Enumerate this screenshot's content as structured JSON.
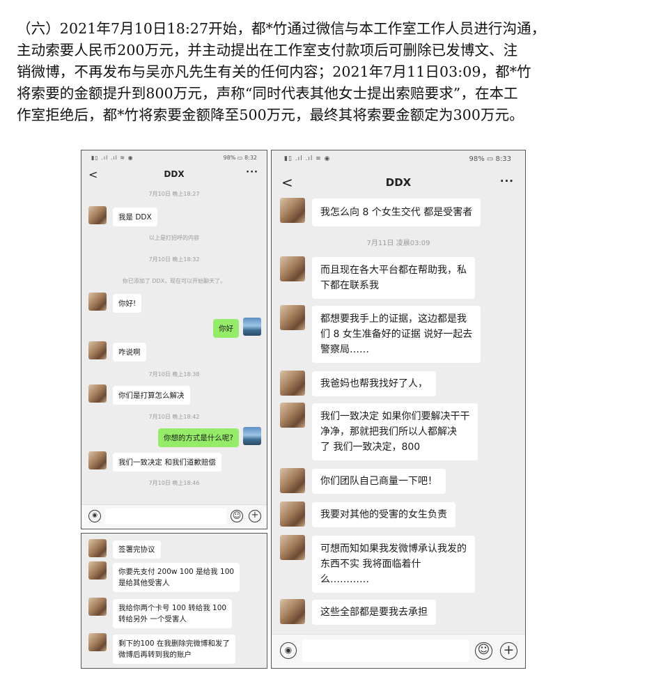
{
  "paragraph": {
    "lines": [
      "（六）2021年7月10日18:27开始，都*竹通过微信与本工作室工作人员进行沟通，",
      "主动索要人民币200万元，并主动提出在工作室支付款项后可删除已发博文、注",
      "销微博，不再发布与吴亦凡先生有关的任何内容；2021年7月11日03:09，都*竹",
      "将索要的金额提升到800万元，声称“同时代表其他女士提出索赔要求”，在本工",
      "作室拒绝后，都*竹将索要金额降至500万元，最终其将索要金额定为300万元。"
    ]
  },
  "phone1": {
    "status_signal": "▮▯ .ıl .ıl ≋ ◉",
    "status_right": "98% ▭ 8:32",
    "back": "<",
    "title": "DDX",
    "more": "···",
    "time1": "7月10日 晚上18:27",
    "msg1": "我是 DDX",
    "sys1": "以上是打招呼的内容",
    "time2": "7月10日 晚上18:32",
    "sys2": "你已添加了 DDX，现在可以开始聊天了。",
    "msg2": "你好!",
    "msg3_me": "你好",
    "msg4": "咋说啊",
    "time3": "7月10日 晚上18:38",
    "msg5": "你们是打算怎么解决",
    "time4": "7月10日 晚上18:42",
    "msg6_me": "你想的方式是什么呢?",
    "msg7": "我们一致决定  和我们道歉赔偿",
    "time5": "7月10日 晚上18:46"
  },
  "phone2": {
    "msgs": [
      [
        "签署完协议"
      ],
      [
        "你要先支付 200w  100 是给我  100",
        "是给其他受害人"
      ],
      [
        "我给你两个卡号  100 转给我  100",
        "转给另外  一个受害人"
      ],
      [
        "剩下的100  在我删除完微博和发了",
        "微博后再转到我的账户"
      ]
    ]
  },
  "phone3": {
    "status_signal": "▮▯ .ıl .ıl ≋ ◉",
    "status_right": "98% ▭ 8:33",
    "back": "<",
    "title": "DDX",
    "more": "···",
    "time1": "7月11日 凌晨03:09",
    "msgs": [
      [
        "我怎么向 8 个女生交代  都是受害者"
      ],
      [
        "而且现在各大平台都在帮助我，私",
        "下都在联系我"
      ],
      [
        "都想要我手上的证据，这边都是我",
        "们 8 女生准备好的证据  说好一起去",
        "警察局……"
      ],
      [
        "我爸妈也帮我找好了人，"
      ],
      [
        "我们一致决定  如果你们要解决干干",
        "净净，那就把我们所以人都解决",
        "了  我们一致决定，800"
      ],
      [
        "你们团队自己商量一下吧！"
      ],
      [
        "我要对其他的受害的女生负责"
      ],
      [
        "可想而知如果我发微博承认我发的",
        "东西不实  我将面临着什",
        "么…………"
      ],
      [
        "这些全部都是要我去承担"
      ]
    ]
  },
  "icons": {
    "voice": "voice-icon",
    "emoji": "emoji-icon",
    "plus": "plus-icon",
    "voice_glyph": "◉",
    "emoji_glyph": "☺",
    "plus_glyph": "+"
  }
}
